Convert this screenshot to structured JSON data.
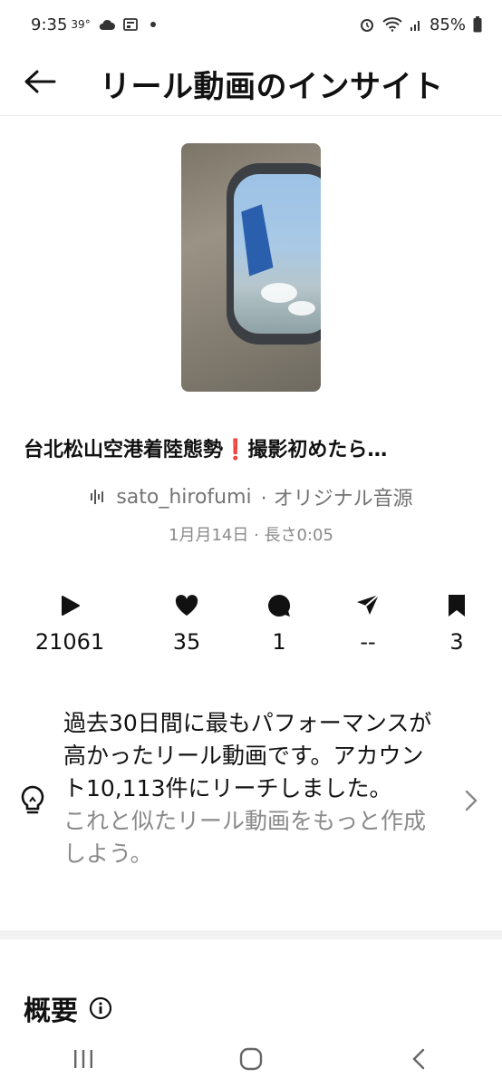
{
  "status": {
    "time": "9:35",
    "temp": "39°",
    "battery": "85%"
  },
  "header": {
    "title": "リール動画のインサイト"
  },
  "post": {
    "title": "台北松山空港着陸態勢❗️撮影初めたら…",
    "audio_user": "sato_hirofumi",
    "audio_label": "· オリジナル音源",
    "meta": "1月月14日 · 長さ0:05"
  },
  "stats": {
    "plays": "21061",
    "likes": "35",
    "comments": "1",
    "shares": "--",
    "saves": "3"
  },
  "insight": {
    "text": "過去30日間に最もパフォーマンスが高かったリール動画です。アカウント10,113件にリーチしました。",
    "sub": "これと似たリール動画をもっと作成しよう。"
  },
  "overview": {
    "title": "概要"
  },
  "colors": {
    "text": "#111111",
    "muted": "#8a8a8a",
    "divider": "#f2f2f2"
  }
}
